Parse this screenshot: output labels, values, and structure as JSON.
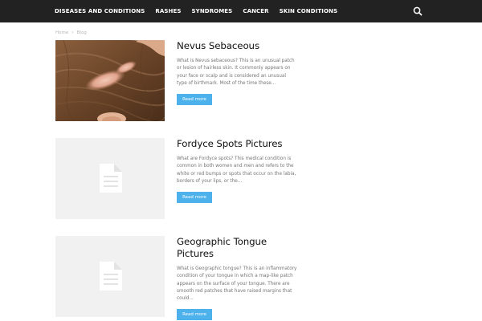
{
  "nav": {
    "items": [
      {
        "label": "DISEASES AND CONDITIONS"
      },
      {
        "label": "RASHES"
      },
      {
        "label": "SYNDROMES"
      },
      {
        "label": "CANCER"
      },
      {
        "label": "SKIN CONDITIONS"
      }
    ],
    "search_icon": "search-icon"
  },
  "breadcrumb": {
    "home": "Home",
    "separator": "›",
    "current": "Blog"
  },
  "posts": [
    {
      "title": "Nevus Sebaceous",
      "excerpt": "What is Nevus sebaceous? This is an unusual patch or lesion of hairless skin. It commonly appears on your face or scalp and is considered an unusual type of birthmark. Most of the time these...",
      "read_more": "Read more",
      "thumbnail": "scalp-photo"
    },
    {
      "title": "Fordyce Spots Pictures",
      "excerpt": "What are Fordyce spots? This medical condition is common in both women and men and refers to the white or red bumps or spots that occur on the labia, borders of your lips, or the...",
      "read_more": "Read more",
      "thumbnail": "placeholder-document-icon"
    },
    {
      "title": "Geographic Tongue Pictures",
      "excerpt": "What is Geographic tongue? This is an inflammatory condition of your tongue in which a map-like patch appears on the surface of your tongue. There are smooth red patches that have raised margins that could...",
      "read_more": "Read more",
      "thumbnail": "placeholder-document-icon"
    }
  ],
  "colors": {
    "topbar": "#222222",
    "button": "#4db2ec",
    "placeholder": "#f1f1f1"
  }
}
